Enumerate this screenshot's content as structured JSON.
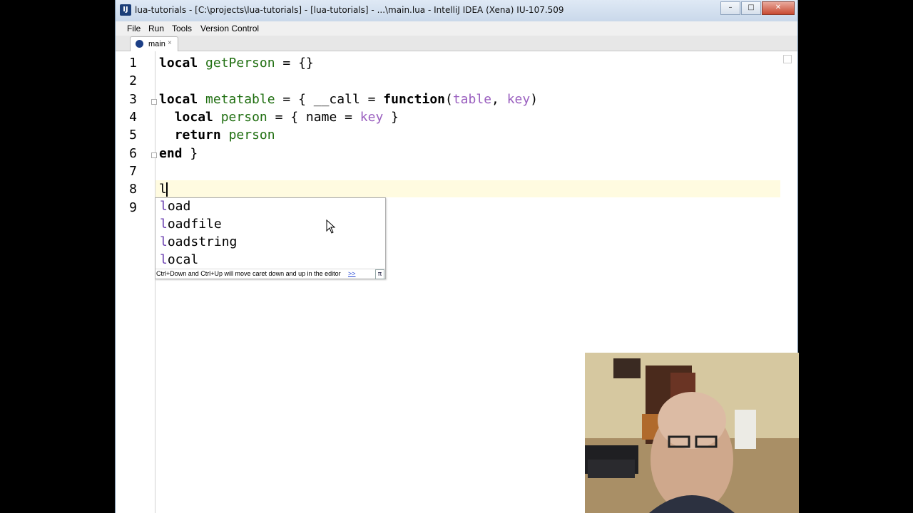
{
  "window": {
    "icon_text": "IJ",
    "title": "lua-tutorials - [C:\\projects\\lua-tutorials] - [lua-tutorials] - ...\\main.lua - IntelliJ IDEA (Xena) IU-107.509",
    "buttons": {
      "minimize": "–",
      "maximize": "□",
      "close": "✕"
    }
  },
  "menu": {
    "items": [
      "File",
      "Run",
      "Tools",
      "Version Control"
    ]
  },
  "tabs": [
    {
      "label": "main",
      "close": "×"
    }
  ],
  "editor": {
    "line_numbers": [
      "1",
      "2",
      "3",
      "4",
      "5",
      "6",
      "7",
      "8",
      "9"
    ],
    "lines": {
      "l1": {
        "kw": "local",
        "name": "getPerson",
        "rest": " = {}"
      },
      "l3": {
        "kw": "local",
        "name": "metatable",
        "mid1": " = { __call = ",
        "fn": "function",
        "paren": "(",
        "p1": "table",
        "comma": ", ",
        "p2": "key",
        "close": ")"
      },
      "l4": {
        "indent": "  ",
        "kw": "local",
        "name": "person",
        "mid": " = { name = ",
        "param": "key",
        "end": " }"
      },
      "l5": {
        "indent": "  ",
        "kw": "return",
        "name": "person"
      },
      "l6": {
        "kw": "end",
        "rest": " }"
      },
      "l8": {
        "typed": "l"
      }
    }
  },
  "completion": {
    "items": [
      {
        "match": "l",
        "rest": "oad"
      },
      {
        "match": "l",
        "rest": "oadfile"
      },
      {
        "match": "l",
        "rest": "oadstring"
      },
      {
        "match": "l",
        "rest": "ocal"
      }
    ],
    "hint": "Ctrl+Down and Ctrl+Up will move caret down and up in the editor",
    "more": ">>",
    "pi": "π"
  },
  "colors": {
    "keyword": "#000000",
    "identifier": "#1f6e10",
    "parameter": "#9a5fbf",
    "caret_line": "#fffbe0",
    "match": "#6b3fb0"
  }
}
